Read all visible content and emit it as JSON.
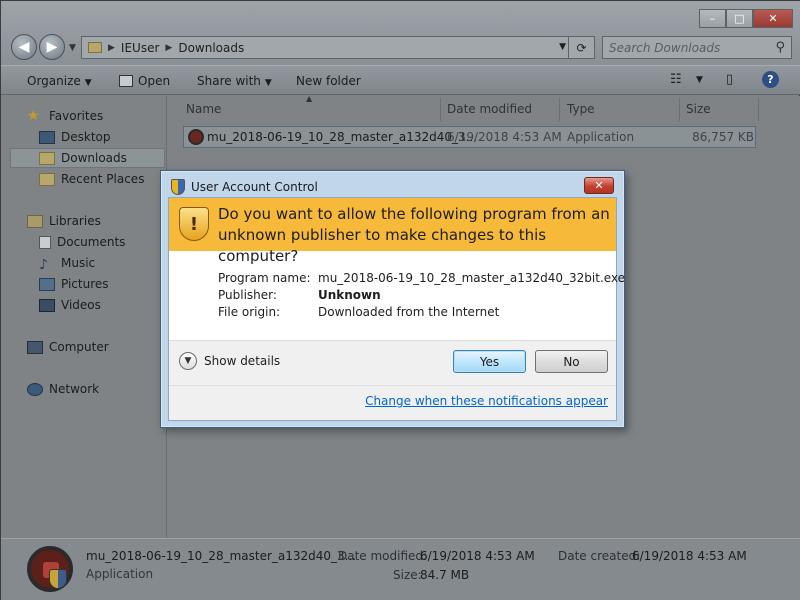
{
  "explorer": {
    "address": {
      "crumbs": [
        "IEUser",
        "Downloads"
      ]
    },
    "search": {
      "placeholder": "Search Downloads"
    },
    "toolbar": {
      "organize": "Organize",
      "open": "Open",
      "share_with": "Share with",
      "new_folder": "New folder"
    },
    "nav": {
      "favorites": "Favorites",
      "desktop": "Desktop",
      "downloads": "Downloads",
      "recent_places": "Recent Places",
      "libraries": "Libraries",
      "documents": "Documents",
      "music": "Music",
      "pictures": "Pictures",
      "videos": "Videos",
      "computer": "Computer",
      "network": "Network"
    },
    "columns": {
      "name": "Name",
      "date_modified": "Date modified",
      "type": "Type",
      "size": "Size"
    },
    "file": {
      "name": "mu_2018-06-19_10_28_master_a132d40_3...",
      "date": "6/19/2018 4:53 AM",
      "type": "Application",
      "size": "86,757 KB"
    },
    "details": {
      "name": "mu_2018-06-19_10_28_master_a132d40_3...",
      "kind": "Application",
      "date_modified_label": "Date modified:",
      "date_modified": "6/19/2018 4:53 AM",
      "date_created_label": "Date created:",
      "date_created": "6/19/2018 4:53 AM",
      "size_label": "Size:",
      "size": "84.7 MB"
    }
  },
  "uac": {
    "title": "User Account Control",
    "question": "Do you want to allow the following program from an unknown publisher to make changes to this computer?",
    "program_name_label": "Program name:",
    "program_name": "mu_2018-06-19_10_28_master_a132d40_32bit.exe",
    "publisher_label": "Publisher:",
    "publisher": "Unknown",
    "file_origin_label": "File origin:",
    "file_origin": "Downloaded from the Internet",
    "show_details": "Show details",
    "yes": "Yes",
    "no": "No",
    "link": "Change when these notifications appear"
  }
}
